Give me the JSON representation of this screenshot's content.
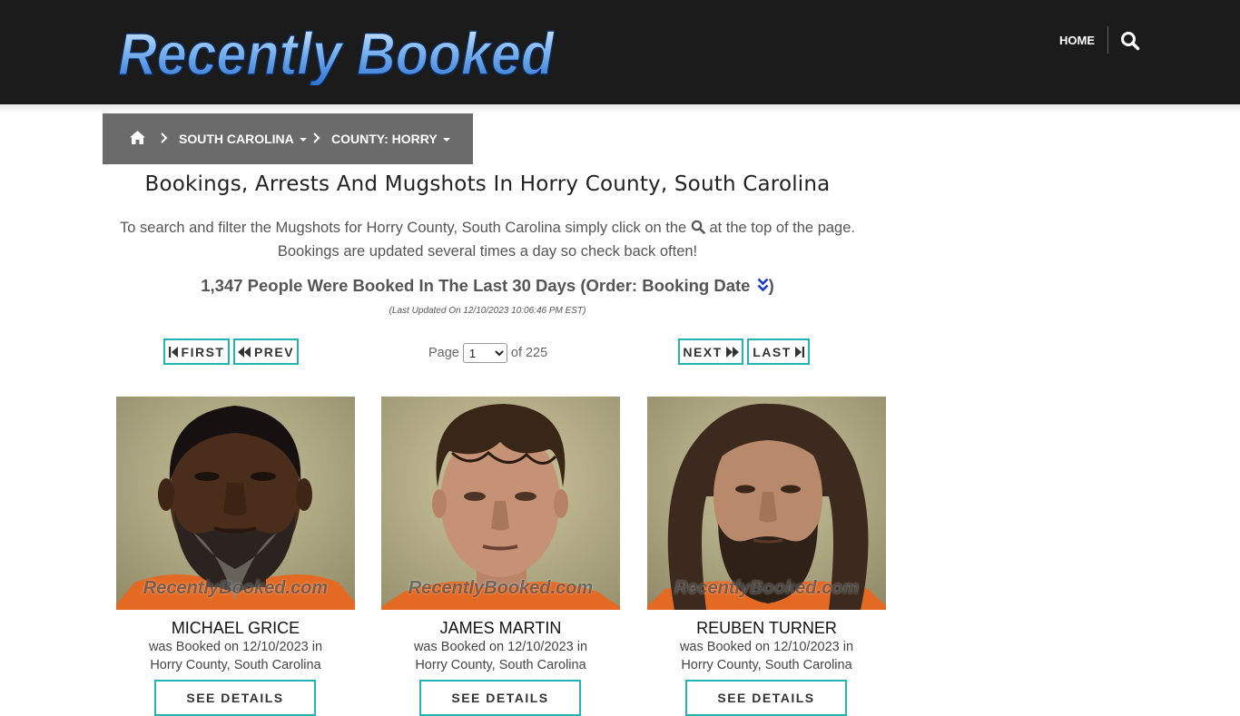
{
  "header": {
    "logo_text": "Recently Booked",
    "nav": {
      "home_label": "HOME"
    }
  },
  "breadcrumb": {
    "state_label": "SOUTH CAROLINA",
    "county_label": "COUNTY: HORRY"
  },
  "page": {
    "title": "Bookings, Arrests And Mugshots In Horry County, South Carolina",
    "intro_before_icon": "To search and filter the Mugshots for Horry County, South Carolina simply click on the",
    "intro_after_icon": "at the top of the page.",
    "intro_line2": "Bookings are updated several times a day so check back often!",
    "summary_before": "1,347 People Were Booked In The Last 30 Days (Order: Booking Date",
    "summary_after": ")",
    "last_updated": "(Last Updated On 12/10/2023 10:06:46 PM EST)"
  },
  "pagination": {
    "first_label": "FIRST",
    "prev_label": "PREV",
    "next_label": "NEXT",
    "last_label": "LAST",
    "page_label": "Page",
    "current_page": "1",
    "of_label": "of 225"
  },
  "watermark": "RecentlyBooked.com",
  "bookings": [
    {
      "name": "MICHAEL GRICE",
      "booked_line": "was Booked on 12/10/2023 in",
      "location": "Horry County, South Carolina",
      "details_label": "SEE DETAILS"
    },
    {
      "name": "JAMES MARTIN",
      "booked_line": "was Booked on 12/10/2023 in",
      "location": "Horry County, South Carolina",
      "details_label": "SEE DETAILS"
    },
    {
      "name": "REUBEN TURNER",
      "booked_line": "was Booked on 12/10/2023 in",
      "location": "Horry County, South Carolina",
      "details_label": "SEE DETAILS"
    }
  ],
  "colors": {
    "header_bg": "#1b1b1b",
    "breadcrumb_bg": "#6b6b6b",
    "button_border": "#22b3b3",
    "order_icon": "#1a3cc8"
  },
  "icons": [
    "home-icon",
    "search-icon",
    "chevron-right-icon",
    "caret-down-icon",
    "double-chevron-down-icon",
    "step-backward-icon",
    "backward-icon",
    "forward-icon",
    "step-forward-icon"
  ]
}
